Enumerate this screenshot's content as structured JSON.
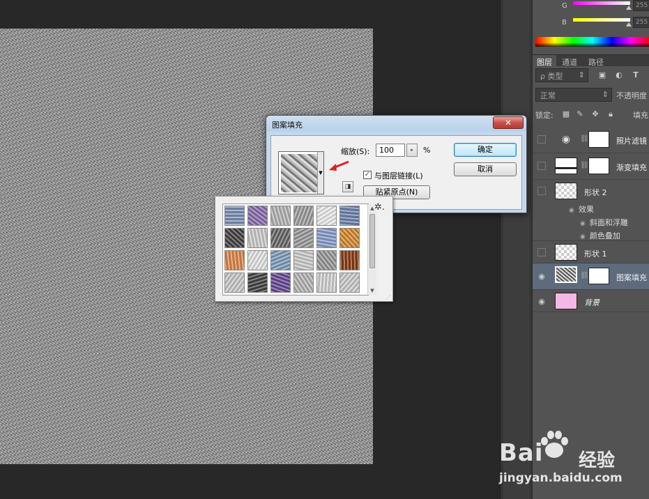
{
  "color_panel": {
    "channels": [
      {
        "label": "G",
        "value": "255",
        "gradient": "#ff00ff"
      },
      {
        "label": "B",
        "value": "255",
        "gradient": "#ffff00"
      }
    ]
  },
  "layers_panel": {
    "tabs": [
      "图层",
      "通道",
      "路径"
    ],
    "filter_label": "ρ 类型",
    "blend_mode": "正常",
    "opacity_label": "不透明度",
    "lock_label": "锁定:",
    "fill_label": "填充",
    "layers": [
      {
        "name": "照片滤镜",
        "visible": false
      },
      {
        "name": "渐变填充",
        "visible": false
      },
      {
        "name": "形状 2",
        "visible": false
      },
      {
        "name": "形状 1",
        "visible": false
      },
      {
        "name": "图案填充",
        "visible": true,
        "selected": true
      },
      {
        "name": "背景",
        "visible": true
      }
    ],
    "effects": {
      "label": "效果",
      "items": [
        "斜面和浮雕",
        "颜色叠加"
      ]
    }
  },
  "dialog": {
    "title": "图案填充",
    "close_label": "✕",
    "scale_label": "缩放(S):",
    "scale_value": "100",
    "percent": "%",
    "link_label": "与图层链接(L)",
    "link_checked": true,
    "snap_label": "贴紧原点(N)",
    "ok_label": "确定",
    "cancel_label": "取消"
  },
  "picker": {
    "gear_label": "✲.",
    "swatch_colors": [
      "#7e93b8",
      "#8a6fb0",
      "#b7b7b7",
      "#a0a0a0",
      "#efefef",
      "#6f86b0",
      "#444444",
      "#d0d0d0",
      "#6a6a6a",
      "#9c9c9c",
      "#8ba0d0",
      "#d88a2c",
      "#e0884c",
      "#e8e8e8",
      "#7fa0c0",
      "#cfcfcf",
      "#9a9a9a",
      "#8a3c12",
      "#cccccc",
      "#444444",
      "#6a4a9a",
      "#b8b8b8",
      "#d6d6d6",
      "#cfcfcf"
    ]
  },
  "watermark": {
    "brand": "Bai",
    "brand_suffix": "经验",
    "url": "jingyan.baidu.com"
  }
}
